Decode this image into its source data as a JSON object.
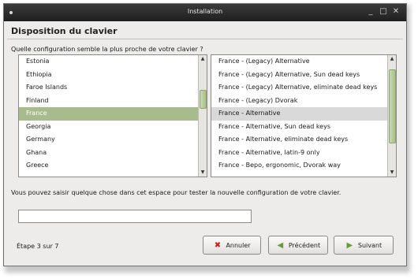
{
  "window": {
    "title": "Installation"
  },
  "header": {
    "title": "Disposition du clavier"
  },
  "question": "Quelle configuration semble la plus proche de votre clavier ?",
  "countries": [
    "Estonia",
    "Ethiopia",
    "Faroe Islands",
    "Finland",
    "France",
    "Georgia",
    "Germany",
    "Ghana",
    "Greece"
  ],
  "countries_selected": "France",
  "variants": [
    "France - (Legacy) Alternative",
    "France - (Legacy) Alternative, Sun dead keys",
    "France - (Legacy) Alternative, eliminate dead keys",
    "France - (Legacy) Dvorak",
    "France - Alternative",
    "France - Alternative, Sun dead keys",
    "France - Alternative, eliminate dead keys",
    "France - Alternative, latin-9 only",
    "France - Bepo, ergonomic, Dvorak way"
  ],
  "variants_selected": "France - Alternative",
  "hint": "Vous pouvez saisir quelque chose dans cet espace pour tester la nouvelle configuration de votre clavier.",
  "test_input": {
    "value": "",
    "placeholder": ""
  },
  "footer": {
    "step": "Étape 3 sur 7",
    "cancel": "Annuler",
    "back": "Précédent",
    "forward": "Suivant"
  },
  "icons": {
    "cancel": "cross-icon",
    "back": "arrow-left-icon",
    "forward": "arrow-right-icon"
  },
  "colors": {
    "selection": "#a7bb8d",
    "titlebar": "#2a2a2a"
  }
}
